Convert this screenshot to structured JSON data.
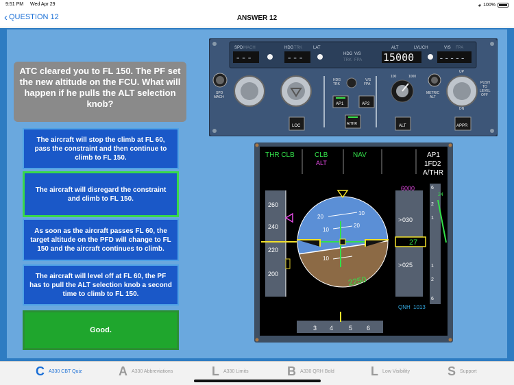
{
  "status_bar": {
    "time": "9:51 PM",
    "date": "Wed Apr 29",
    "battery": "100%",
    "wifi_icon": "wifi-icon"
  },
  "nav": {
    "back_label": "QUESTION 12",
    "title": "ANSWER 12"
  },
  "question": "ATC cleared you to FL 150. The PF set the new altitude on the FCU. What will happen if he pulls the ALT selection knob?",
  "answers": [
    {
      "text": "The aircraft will stop the climb at FL 60, pass the constraint and then continue to climb to FL 150.",
      "selected": false
    },
    {
      "text": "The aircraft will disregard the constraint and climb to FL 150.",
      "selected": true
    },
    {
      "text": "As soon as the aircraft passes FL 60, the target altitude on the PFD will change to FL 150 and the aircraft continues to climb.",
      "selected": false
    },
    {
      "text": "The aircraft will level off at FL 60, the PF has to pull the ALT selection knob a second time to climb to FL 150.",
      "selected": false
    }
  ],
  "result": "Good.",
  "fcu": {
    "spd_label": "SPD",
    "mach_label": "MACH",
    "spd_display": "---",
    "hdg_label": "HDG",
    "trk_label": "TRK",
    "lat_label": "LAT",
    "hdg_display": "---",
    "hdg_vs_label": "HDG",
    "vs_label": "V/S",
    "trk_fpa_label": "TRK",
    "fpa_label": "FPA",
    "alt_label": "ALT",
    "lvlch_label": "LVL/CH",
    "vs2_label": "V/S",
    "fpa2_label": "FPA",
    "alt_display": "15000",
    "vs_display": "-----",
    "spd_mach_button": "SPD MACH",
    "hdg_trk_label": "HDG TRK",
    "vs_fpa_label": "V/S FPA",
    "ap1": "AP1",
    "ap2": "AP2",
    "athr": "A/THR",
    "loc": "LOC",
    "alt_button": "ALT",
    "appr": "APPR",
    "metric_alt": "METRIC ALT",
    "alt_100": "100",
    "alt_1000": "1000",
    "push_to_level_off": "PUSH TO LEVEL OFF",
    "up": "UP",
    "dn": "DN"
  },
  "pfd": {
    "fma": {
      "thrust": "THR CLB",
      "vertical": "CLB",
      "vertical_armed": "ALT",
      "lateral": "NAV",
      "ap": "AP1",
      "fd": "1FD2",
      "athr": "A/THR"
    },
    "speed_ticks": [
      "260",
      "240",
      "220",
      "200"
    ],
    "alt_ticks": [
      "030",
      "025"
    ],
    "alt_target": "6000",
    "alt_current": "27",
    "pitch_labels": [
      "20",
      "10",
      "10",
      "20",
      "10"
    ],
    "radio_alt": "2250",
    "vs_value": "24",
    "qnh_label": "QNH",
    "qnh_value": "1013",
    "heading_ticks": [
      "3",
      "4",
      "5",
      "6"
    ],
    "vsi_ticks": [
      "6",
      "2",
      "1",
      "1",
      "2",
      "6"
    ]
  },
  "tabs": [
    {
      "letter": "C",
      "label": "A330 CBT Quiz",
      "active": true
    },
    {
      "letter": "A",
      "label": "A330 Abbreviations",
      "active": false
    },
    {
      "letter": "L",
      "label": "A330 Limits",
      "active": false
    },
    {
      "letter": "B",
      "label": "A330 QRH Bold",
      "active": false
    },
    {
      "letter": "L",
      "label": "Low Visibility",
      "active": false
    },
    {
      "letter": "S",
      "label": "Support",
      "active": false
    }
  ],
  "colors": {
    "accent": "#1a6fd6",
    "background_blue": "#2e7cc2",
    "answer_blue": "#1a58c8",
    "good_green": "#1fa62d",
    "selected_border": "#38d94a"
  }
}
